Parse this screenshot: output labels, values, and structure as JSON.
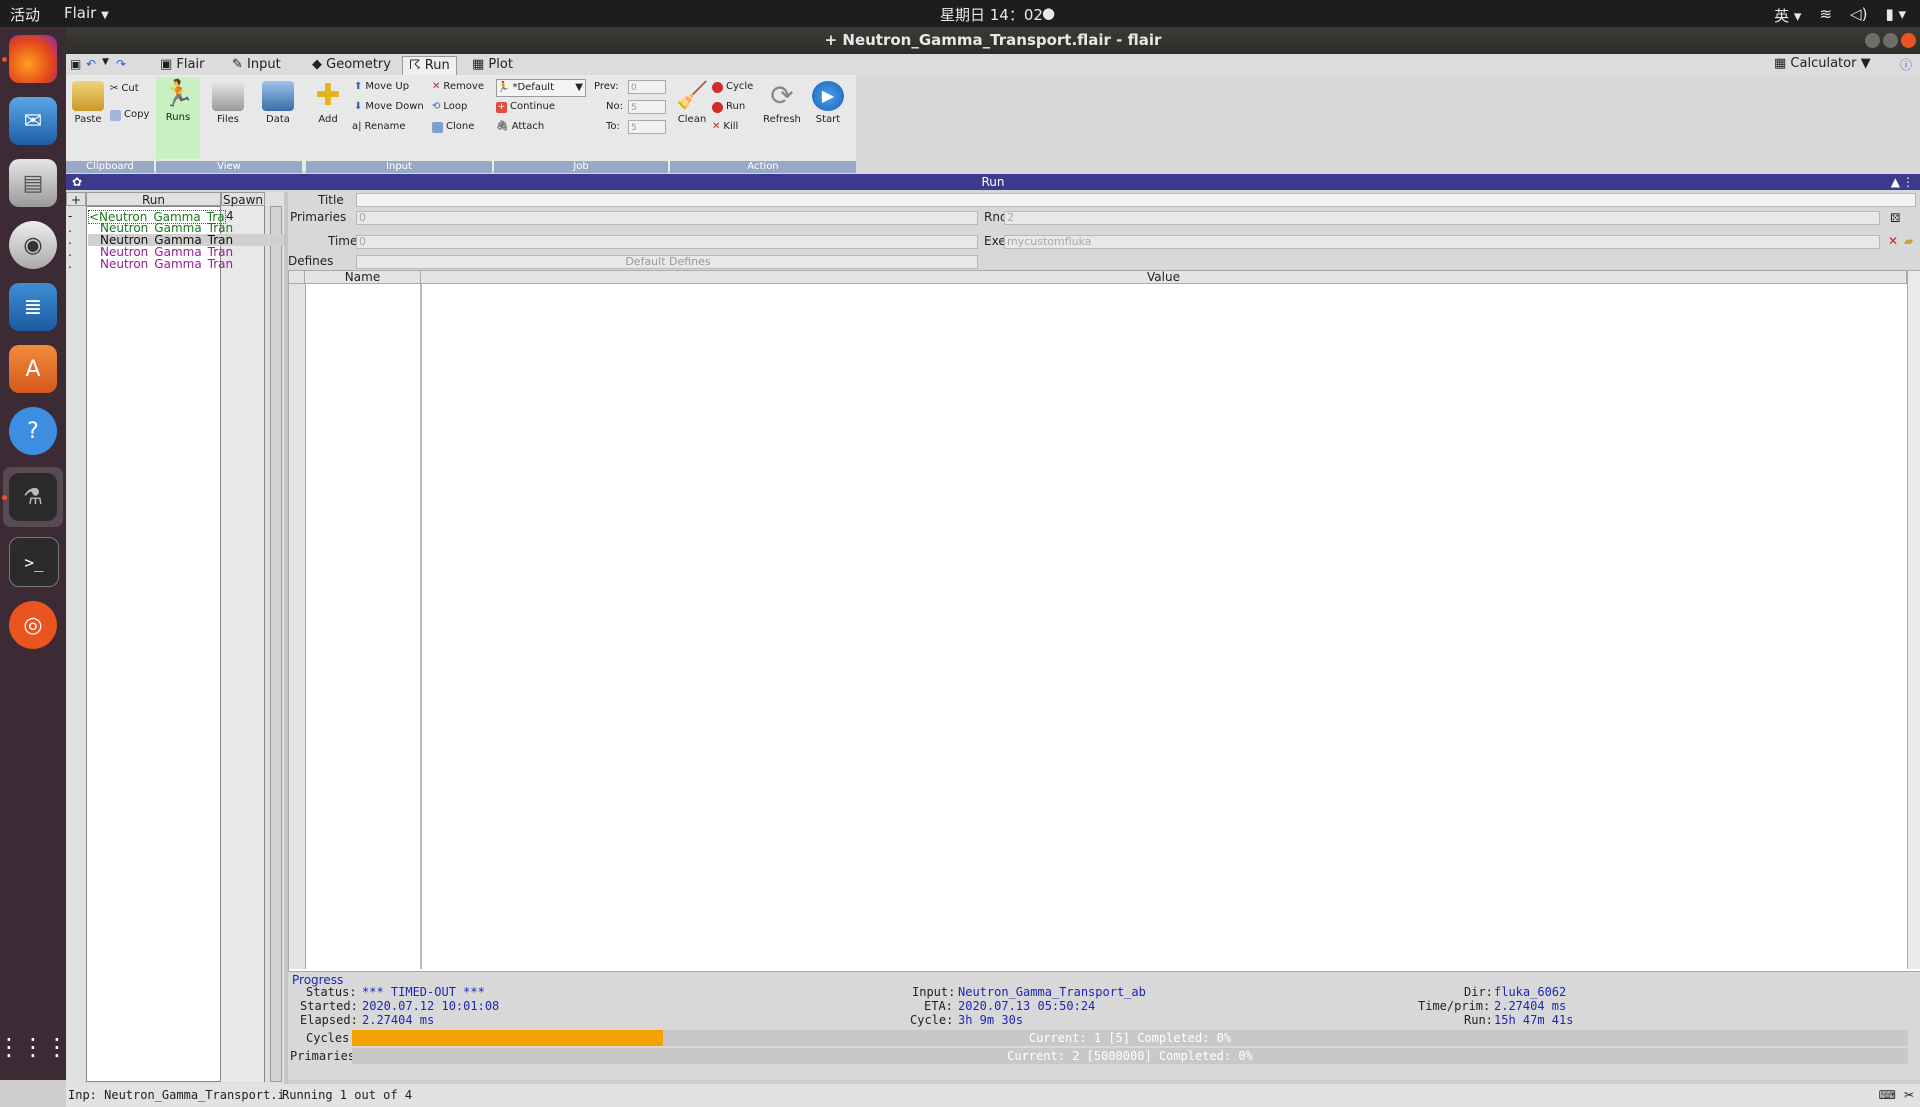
{
  "topbar": {
    "activities": "活动",
    "app_menu": "Flair",
    "clock": "星期日 14：02",
    "ime": "英"
  },
  "dock": {
    "items": [
      {
        "name": "firefox"
      },
      {
        "name": "thunderbird"
      },
      {
        "name": "files"
      },
      {
        "name": "rhythmbox"
      },
      {
        "name": "libreoffice-writer"
      },
      {
        "name": "software"
      },
      {
        "name": "help"
      },
      {
        "name": "flair"
      },
      {
        "name": "terminal"
      },
      {
        "name": "ubuntu"
      }
    ]
  },
  "window": {
    "title": "+ Neutron_Gamma_Transport.flair - flair"
  },
  "tabs": [
    {
      "label": "Flair"
    },
    {
      "label": "Input"
    },
    {
      "label": "Geometry"
    },
    {
      "label": "Run"
    },
    {
      "label": "Plot"
    }
  ],
  "calculator_label": "Calculator",
  "ribbon": {
    "clipboard": {
      "paste": "Paste",
      "cut": "Cut",
      "copy": "Copy",
      "label": "Clipboard"
    },
    "view": {
      "runs": "Runs",
      "files": "Files",
      "data": "Data",
      "label": "View"
    },
    "input": {
      "add": "Add",
      "move_up": "Move Up",
      "move_down": "Move Down",
      "rename": "Rename",
      "remove": "Remove",
      "loop": "Loop",
      "clone": "Clone",
      "label": "Input"
    },
    "job": {
      "queue": "*Default",
      "continue": "Continue",
      "attach": "Attach",
      "prev": "Prev:",
      "no": "No:",
      "to": "To:",
      "prev_val": "0",
      "no_val": "5",
      "to_val": "5",
      "label": "Job"
    },
    "action": {
      "clean": "Clean",
      "cycle": "Cycle",
      "run": "Run",
      "kill": "Kill",
      "refresh": "Refresh",
      "start": "Start",
      "label": "Action"
    }
  },
  "run_header": "Run",
  "tree": {
    "col_run": "Run",
    "col_spawn": "Spawn",
    "rows": [
      {
        "prefix": "-",
        "label": "<Neutron_Gamma_Trans",
        "spawn": "4",
        "color": "#1a7a1a"
      },
      {
        "prefix": ".",
        "label": "Neutron_Gamma_Tran",
        "spawn": "",
        "color": "#1a7a1a"
      },
      {
        "prefix": ".",
        "label": "Neutron_Gamma_Tran",
        "spawn": "",
        "color": "#111111"
      },
      {
        "prefix": ".",
        "label": "Neutron_Gamma_Tran",
        "spawn": "",
        "color": "#9a1a9a"
      },
      {
        "prefix": ".",
        "label": "Neutron_Gamma_Tran",
        "spawn": "",
        "color": "#9a1a9a"
      }
    ]
  },
  "form": {
    "title_label": "Title",
    "primaries_label": "Primaries",
    "primaries_val": "0",
    "rnd_label": "Rnd",
    "rnd_val": "2",
    "time_label": "Time",
    "time_val": "0",
    "exe_label": "Exe",
    "exe_val": "mycustomfluka",
    "defines_label": "Defines",
    "defines_button": "Default Defines"
  },
  "table": {
    "col_name": "Name",
    "col_value": "Value"
  },
  "progress": {
    "legend": "Progress",
    "status_label": "Status:",
    "status_val": "*** TIMED-OUT ***",
    "started_label": "Started:",
    "started_val": "2020.07.12 10:01:08",
    "elapsed_label": "Elapsed:",
    "elapsed_val": "2.27404 ms",
    "input_label": "Input:",
    "input_val": "Neutron_Gamma_Transport_ab",
    "eta_label": "ETA:",
    "eta_val": "2020.07.13 05:50:24",
    "cycle_label": "Cycle:",
    "cycle_val": "3h 9m 30s",
    "dir_label": "Dir:",
    "dir_val": "fluka_6062",
    "timeprim_label": "Time/prim:",
    "timeprim_val": "2.27404 ms",
    "run_label": "Run:",
    "run_val": "15h 47m 41s",
    "cycles_label": "Cycles:",
    "cycles_text": "Current: 1 [5]  Completed: 0%",
    "cycles_fill": 0.2,
    "primaries_label": "Primaries:",
    "primaries_text": "Current: 2 [5000000]  Completed: 0%",
    "primaries_fill": 0.0
  },
  "statusbar": {
    "inp": "Inp: Neutron_Gamma_Transport.i",
    "running": "Running 1 out of 4"
  },
  "colors": {
    "run_header": "#3b3a8c",
    "progress_fill": "#f5a200",
    "value_text": "#1c27b5"
  }
}
